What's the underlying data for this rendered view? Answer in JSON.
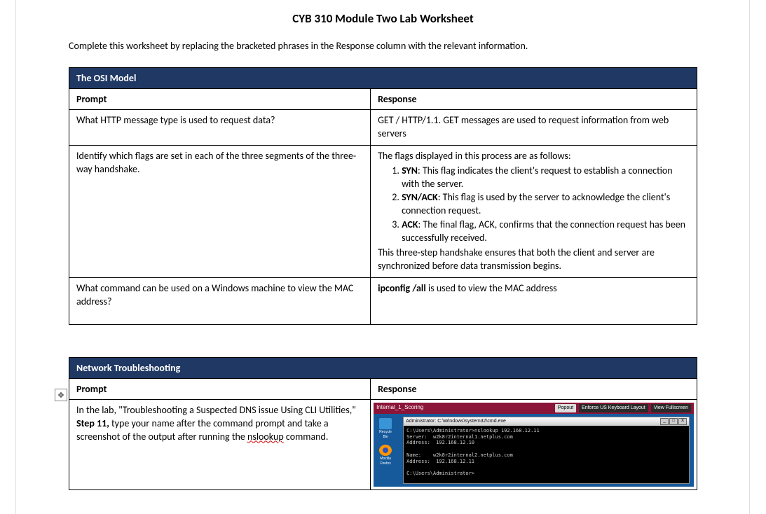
{
  "doc": {
    "title": "CYB 310 Module Two Lab Worksheet",
    "instructions": "Complete this worksheet by replacing the bracketed phrases in the Response column with the relevant information."
  },
  "table1": {
    "section": "The OSI Model",
    "headers": {
      "prompt": "Prompt",
      "response": "Response"
    },
    "rows": {
      "r1": {
        "prompt": "What HTTP message type is used to request data?",
        "response": "GET / HTTP/1.1. GET messages are used to request information from web servers"
      },
      "r2": {
        "prompt": "Identify which flags are set in each of the three segments of the three-way handshake.",
        "intro": "The flags displayed in this process are as follows:",
        "flag1_name": "SYN",
        "flag1_desc": ": This flag indicates the client's request to establish a connection with the server.",
        "flag2_name": "SYN/ACK",
        "flag2_desc": ": This flag is used by the server to acknowledge the client's connection request.",
        "flag3_name": "ACK",
        "flag3_desc": ": The final flag, ACK, confirms that the connection request has been successfully received.",
        "outro": "This three-step handshake ensures that both the client and server are synchronized before data transmission begins."
      },
      "r3": {
        "prompt": "What command can be used on a Windows machine to view the MAC address?",
        "cmd": "ipconfig /all",
        "rest": " is used to view the MAC address"
      }
    }
  },
  "table2": {
    "section": "Network Troubleshooting",
    "headers": {
      "prompt": "Prompt",
      "response": "Response"
    },
    "rows": {
      "r1": {
        "p1": "In the lab, \"Troubleshooting a Suspected DNS issue Using CLI Utilities,\" ",
        "step": "Step 11,",
        "p2": " type your name after the command prompt and take a screenshot of the output after running the ",
        "cmdword": "nslookup",
        "p3": " command."
      }
    }
  },
  "vm": {
    "topbar_title": "Internal_1_Scoring",
    "btn_popout": "Popout",
    "btn_keyboard": "Enforce US Keyboard Layout",
    "btn_fullscreen": "View Fullscreen",
    "icon_recycle": "Recycle Bin",
    "icon_firefox": "Mozilla Firefox",
    "cmd_title": "Administrator: C:\\Windows\\system32\\cmd.exe",
    "cmd_min": "_",
    "cmd_max": "□",
    "cmd_close": "X",
    "cmd_text": "C:\\Users\\Administrator>nslookup 192.168.12.11\nServer:  w2k8r2internal1.netplus.com\nAddress:  192.168.12.10\n\nName:    w2k8r2internal2.netplus.com\nAddress:  192.168.12.11\n\nC:\\Users\\Administrator>"
  },
  "anchor_glyph": "✥"
}
